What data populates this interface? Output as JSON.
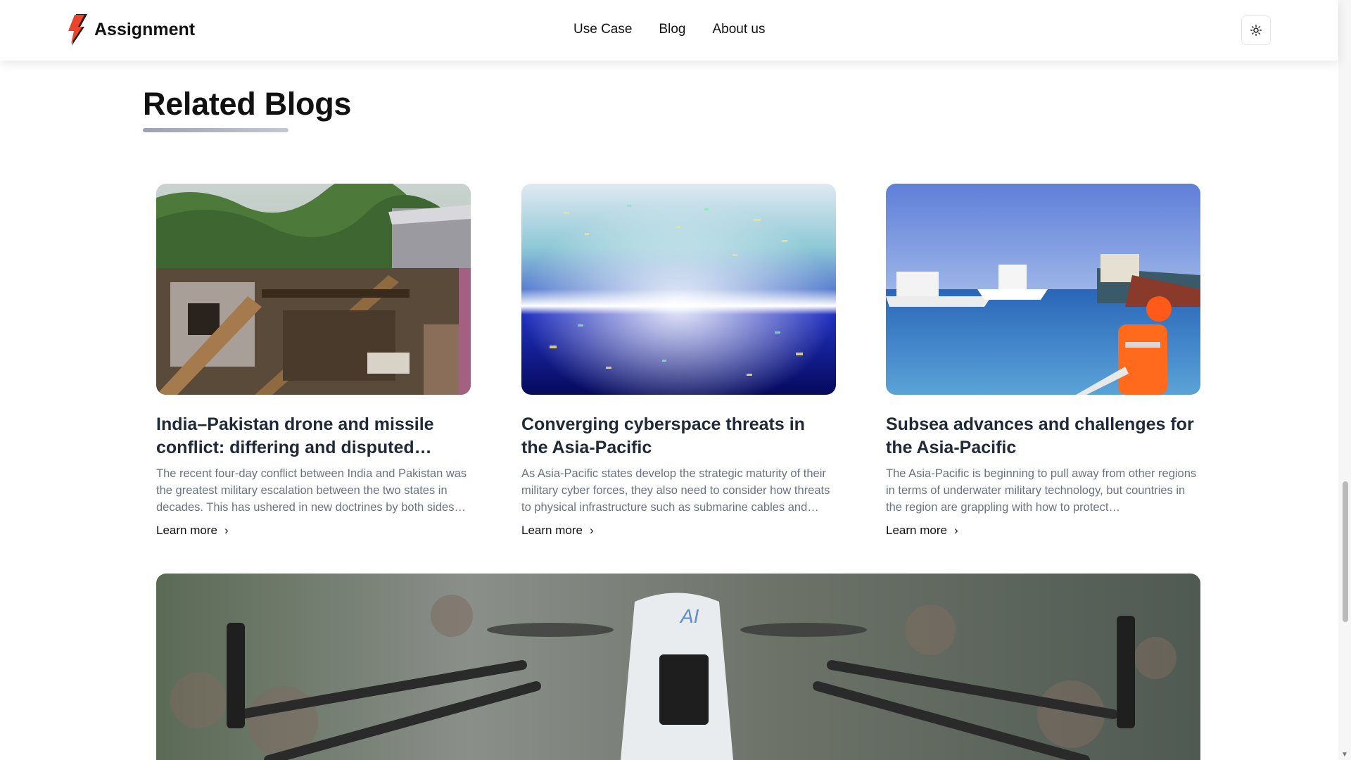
{
  "header": {
    "brand": "Assignment",
    "nav": [
      "Use Case",
      "Blog",
      "About us"
    ]
  },
  "section": {
    "title": "Related Blogs"
  },
  "cards": [
    {
      "title": "India–Pakistan drone and missile conflict: differing and disputed…",
      "description": "The recent four-day conflict between India and Pakistan was the greatest military escalation between the two states in decades. This has ushered in new doctrines by both sides…",
      "link": "Learn more"
    },
    {
      "title": "Converging cyberspace threats in the Asia-Pacific",
      "description": "As Asia-Pacific states develop the strategic maturity of their military cyber forces, they also need to consider how threats to physical infrastructure such as submarine cables and…",
      "link": "Learn more"
    },
    {
      "title": "Subsea advances and challenges for the Asia-Pacific",
      "description": "The Asia-Pacific is beginning to pull away from other regions in terms of underwater military technology, but countries in the region are grappling with how to protect…",
      "link": "Learn more"
    }
  ],
  "colors": {
    "logo_red": "#e8452c",
    "logo_dark": "#1f1f1f",
    "underline": "#9ba3b2"
  },
  "icons": {
    "theme_toggle": "sun-icon",
    "link_arrow": "chevron-right-icon"
  }
}
